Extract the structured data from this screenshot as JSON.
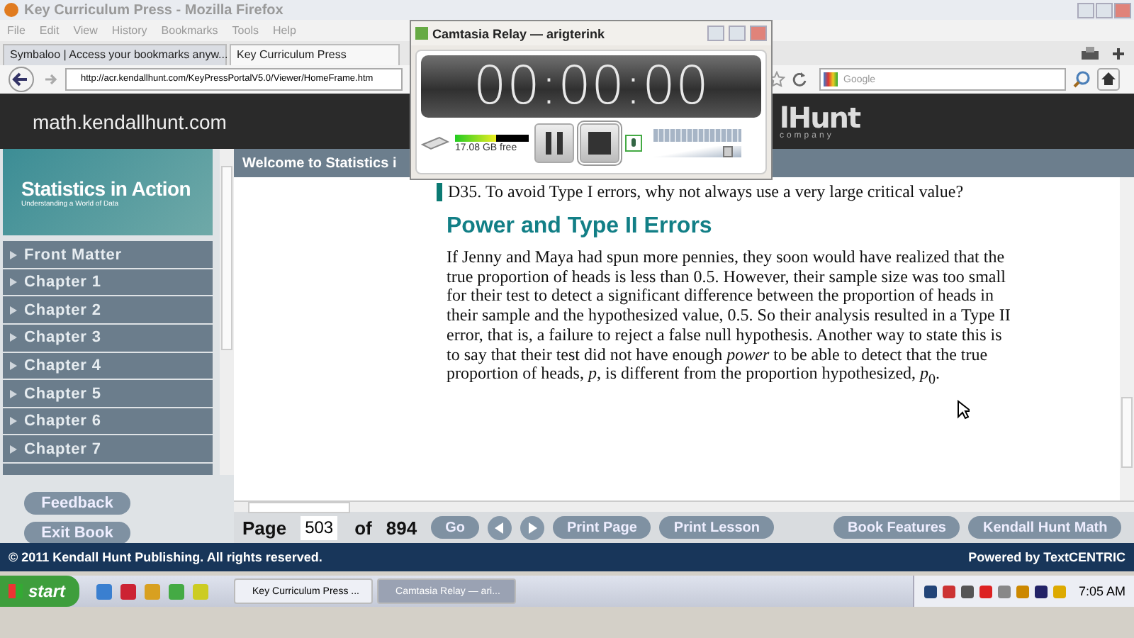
{
  "browser": {
    "title": "Key Curriculum Press - Mozilla Firefox",
    "menu": [
      "File",
      "Edit",
      "View",
      "History",
      "Bookmarks",
      "Tools",
      "Help"
    ],
    "tabs": [
      {
        "label": "Symbaloo | Access your bookmarks anyw...",
        "selected": false
      },
      {
        "label": "Key Curriculum Press",
        "selected": true
      }
    ],
    "url": "http://acr.kendallhunt.com/KeyPressPortalV5.0/Viewer/HomeFrame.htm",
    "search": {
      "placeholder": "Google"
    }
  },
  "site": {
    "domain": "math.kendallhunt.com",
    "logo": "lHunt",
    "logo_sub": "company"
  },
  "sidebar": {
    "cover": {
      "title": "Statistics in Action",
      "subtitle": "Understanding a World of Data"
    },
    "items": [
      "Front Matter",
      "Chapter 1",
      "Chapter 2",
      "Chapter 3",
      "Chapter 4",
      "Chapter 5",
      "Chapter 6",
      "Chapter 7"
    ],
    "buttons": [
      "Feedback",
      "Exit Book"
    ]
  },
  "content": {
    "header": "Welcome to Statistics i",
    "question": "D35. To avoid Type I errors, why not always use a very large critical value?",
    "heading": "Power and Type II Errors",
    "paragraph": "If Jenny and Maya had spun more pennies, they soon would have realized that the true proportion of heads is less than 0.5. However, their sample size was too small for their test to detect a significant difference between the proportion of heads in their sample and the hypothesized value, 0.5. So their analysis resulted in a Type II error, that is, a failure to reject a false null hypothesis. Another way to state this is to say that their test did not have enough *power* to be able to detect that the true proportion of heads, *p*, is different from the proportion hypothesized, *p*$_{0}$."
  },
  "pager": {
    "label": "Page",
    "value": "503",
    "of": "of",
    "total": "894",
    "buttons": [
      {
        "kind": "text",
        "label": "Go"
      },
      {
        "kind": "prev"
      },
      {
        "kind": "next"
      },
      {
        "kind": "text",
        "label": "Print Page"
      },
      {
        "kind": "text",
        "label": "Print Lesson"
      },
      {
        "kind": "spacer"
      },
      {
        "kind": "text",
        "label": "Book Features"
      },
      {
        "kind": "text",
        "label": "Kendall Hunt Math"
      }
    ]
  },
  "footer": {
    "copyright": "© 2011 Kendall Hunt Publishing. All rights reserved.",
    "powered": "Powered by TextCENTRIC"
  },
  "recorder": {
    "title": "Camtasia Relay — arigterink",
    "time": "00:00:00",
    "disk": {
      "level": 0.55,
      "reading": "17.08 GB free"
    },
    "volume": {
      "level": 0.85
    }
  },
  "taskbar": {
    "start": "start",
    "tasks": [
      {
        "label": "Key Curriculum Press ...",
        "selected": false
      },
      {
        "label": "Camtasia Relay — ari...",
        "selected": true
      }
    ],
    "clock": "7:05 AM"
  }
}
